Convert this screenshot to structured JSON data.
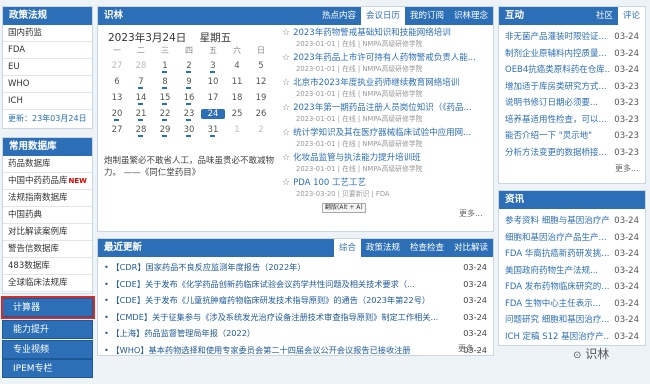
{
  "sidebar": {
    "header": "政策法规",
    "items": [
      "国内药监",
      "FDA",
      "EU",
      "WHO",
      "ICH"
    ],
    "update": "更新：23年03月24日",
    "db_header": "常用数据库",
    "db_items": [
      {
        "label": "药品数据库",
        "new": ""
      },
      {
        "label": "中国中药药品库",
        "new": "NEW"
      },
      {
        "label": "法规指南数据库",
        "new": ""
      },
      {
        "label": "中国药典",
        "new": ""
      },
      {
        "label": "对比解读案例库",
        "new": ""
      },
      {
        "label": "警告信数据库",
        "new": ""
      },
      {
        "label": "483数据库",
        "new": ""
      },
      {
        "label": "全球临床法规库",
        "new": ""
      }
    ],
    "buttons": [
      "计算器",
      "能力提升",
      "专业视频",
      "IPEM专栏"
    ]
  },
  "knowledge": {
    "title": "识林",
    "tabs": [
      "热点内容",
      "会议日历",
      "我的订阅",
      "识林理念"
    ],
    "active_tab": 1,
    "date": "2023年3月24日",
    "weekday": "星期五",
    "weekdays": [
      "一",
      "二",
      "三",
      "四",
      "五",
      "六",
      "日"
    ],
    "weeks": [
      [
        "27",
        "28",
        "1",
        "2",
        "3",
        "4",
        "5"
      ],
      [
        "6",
        "7",
        "8",
        "9",
        "10",
        "11",
        "12"
      ],
      [
        "13",
        "14",
        "15",
        "16",
        "17",
        "18",
        "19"
      ],
      [
        "20",
        "21",
        "22",
        "23",
        "24",
        "25",
        "26"
      ],
      [
        "27",
        "28",
        "29",
        "30",
        "31",
        "1",
        "2"
      ]
    ],
    "today": "24",
    "quote": "炮制虽繁必不敢省人工，品味虽贵必不敢减物力。 ——《同仁堂药目》",
    "news": [
      {
        "title": "2023年药物警戒基础知识和技能网络培训",
        "meta": "2023-01-01 | 在线 | NMPA高级研修学院"
      },
      {
        "title": "2023年药品上市许可持有人药物警戒负责人能...",
        "meta": "2023-01-01 | 在线 | NMPA高级研修学院"
      },
      {
        "title": "北京市2023年度执业药师继续教育网络培训",
        "meta": "2023-01-01 | 在线 | NMPA高级研修学院"
      },
      {
        "title": "2023年第一期药品注册人员岗位知识（《药品...",
        "meta": "2023-01-01 | 在线 | NMPA高级研修学院"
      },
      {
        "title": "统计学知识及其在医疗器械临床试验中应用网...",
        "meta": "2023-01-01 | 在线 | NMPA高级研修学院"
      },
      {
        "title": "化妆品监管与执法能力提升培训班",
        "meta": "2023-01-01 | 在线 | NMPA高级研修学院"
      },
      {
        "title": "PDA 100 工艺工艺",
        "meta": "2023-03-20 | 贝要新识 | FDA"
      }
    ],
    "tooltip": "翻版(Alt + A)",
    "more": "更多..."
  },
  "hot": {
    "title": "互动",
    "tabs": [
      "社区",
      "评论"
    ],
    "active_tab": 1,
    "items": [
      {
        "text": "非无菌产品灌装时限验证...",
        "date": "03-24"
      },
      {
        "text": "制剂企业原辅料内控质量...",
        "date": "03-24"
      },
      {
        "text": "OEB4抗癌类原料药在仓库...",
        "date": "03-24"
      },
      {
        "text": "增加适于库房类研究方式...",
        "date": "03-23"
      },
      {
        "text": "说明书修订日期必须要...",
        "date": "03-23"
      },
      {
        "text": "培养基适用性检查，可以...",
        "date": "03-23"
      },
      {
        "text": "能否介绍一下 \"灵示地\"",
        "date": "03-23"
      },
      {
        "text": "分析方法变更的数据桥接...",
        "date": "03-23"
      }
    ],
    "more": "更多..."
  },
  "updates": {
    "title": "最近更新",
    "tabs": [
      "综合",
      "政策法规",
      "检查检查",
      "对比解读"
    ],
    "active_tab": 0,
    "items": [
      {
        "text": "【CDR】国家药品不良反应监测年度报告（2022年）",
        "date": "03-24"
      },
      {
        "text": "【CDE】关于发布《化学药品创新药临床试验会议药学共性问题及相关技术要求（...",
        "date": "03-24"
      },
      {
        "text": "【CDE】关于发布《儿童抗肿瘤药物临床研发技术指导原则》的通告（2023年第22号）",
        "date": "03-24"
      },
      {
        "text": "【CMDE】关于征集参与《涉及系统发光治疗设备注册技术审查指导原则》制定工作相关...",
        "date": "03-24"
      },
      {
        "text": "【上海】药品监督管理局年报（2022）",
        "date": "03-24"
      },
      {
        "text": "【WHO】基本药物选择和使用专家委员会第二十四届会议公开会议报告已接收注册",
        "date": "03-24"
      }
    ],
    "more": "更多..."
  },
  "resources": {
    "title": "资讯",
    "items": [
      {
        "text": "参考资料 细胞与基因治疗产...",
        "date": "03-24"
      },
      {
        "text": "细胞和基因治疗产品生产...",
        "date": "03-24"
      },
      {
        "text": "FDA 华裔抗癌新药研发挑...",
        "date": "03-24"
      },
      {
        "text": "美国政府药物生产法规...",
        "date": "03-24"
      },
      {
        "text": "FDA 发布药物临床研究的...",
        "date": "03-24"
      },
      {
        "text": "FDA 生物中心主任表示...",
        "date": "03-24"
      },
      {
        "text": "问题研究 细胞和基因治疗...",
        "date": "03-24"
      },
      {
        "text": "ICH 定稿 S12 基因治疗产...",
        "date": "03-24"
      }
    ]
  },
  "watermark": "识林"
}
